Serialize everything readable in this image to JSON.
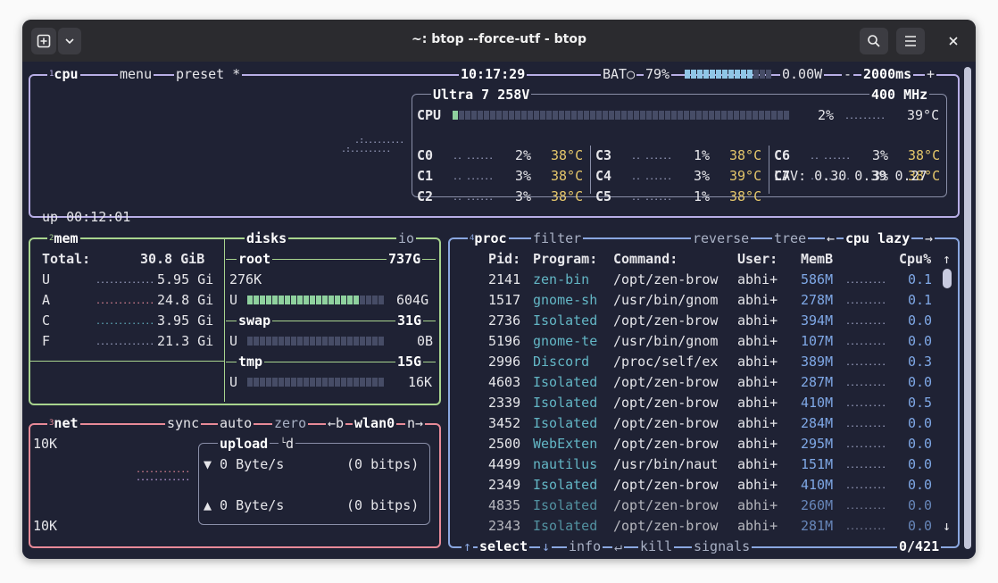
{
  "window": {
    "title": "~: btop --force-utf - btop"
  },
  "titlebar_icons": [
    "new-tab-icon",
    "chevron-down-icon",
    "search-icon",
    "hamburger-icon",
    "close-icon"
  ],
  "colors": {
    "cpu_border": "#b8aee6",
    "mem_border": "#a8d48e",
    "net_border": "#e88a98",
    "proc_border": "#8aa7e0",
    "bg": "#1f2234"
  },
  "cpu": {
    "tab": "cpu",
    "tab_num": "1",
    "menu": "menu",
    "preset": "preset *",
    "time": "10:17:29",
    "battery_label": "BAT○",
    "battery_pct": "79%",
    "battery_value": 0.79,
    "power": "0.00W",
    "interval": "2000ms",
    "interval_minus": "-",
    "interval_plus": "+",
    "model": "Ultra 7 258V",
    "freq": "400 MHz",
    "uptime": "up 00:12:01",
    "total": {
      "label": "CPU",
      "pct": "2%",
      "temp": "39°C"
    },
    "cores": [
      {
        "name": "C0",
        "pct": "2%",
        "temp": "38°C"
      },
      {
        "name": "C1",
        "pct": "3%",
        "temp": "38°C"
      },
      {
        "name": "C2",
        "pct": "3%",
        "temp": "38°C"
      },
      {
        "name": "C3",
        "pct": "1%",
        "temp": "38°C"
      },
      {
        "name": "C4",
        "pct": "3%",
        "temp": "39°C"
      },
      {
        "name": "C5",
        "pct": "1%",
        "temp": "38°C"
      },
      {
        "name": "C6",
        "pct": "3%",
        "temp": "38°C"
      },
      {
        "name": "C7",
        "pct": "3%",
        "temp": "38°C"
      }
    ],
    "lav": "LAV: 0.30 0.39 0.27"
  },
  "mem": {
    "tab": "mem",
    "tab_num": "2",
    "total_label": "Total:",
    "total": "30.8 GiB",
    "rows": [
      {
        "k": "U",
        "v": "5.95 Gi"
      },
      {
        "k": "A",
        "v": "24.8 Gi"
      },
      {
        "k": "C",
        "v": "3.95 Gi"
      },
      {
        "k": "F",
        "v": "21.3 Gi"
      }
    ]
  },
  "disks": {
    "tab": "disks",
    "io": "io",
    "root": {
      "name": "root",
      "size": "737G",
      "io": "276K",
      "used_label": "U",
      "used": "604G",
      "used_frac": 0.82
    },
    "swap": {
      "name": "swap",
      "size": "31G",
      "used_label": "U",
      "used": "0B"
    },
    "tmp": {
      "name": "tmp",
      "size": "15G",
      "used_label": "U",
      "used": "16K"
    }
  },
  "net": {
    "tab": "net",
    "tab_num": "3",
    "sync": "sync",
    "auto": "auto",
    "zero": "zero",
    "b": "←b",
    "iface": "wlan0",
    "n": "n→",
    "top": "10K",
    "bottom": "10K",
    "upload_label": "upload",
    "d": "d",
    "down": "▼ 0 Byte/s",
    "down_bits": "(0 bitps)",
    "up": "▲ 0 Byte/s",
    "up_bits": "(0 bitps)"
  },
  "proc": {
    "tab": "proc",
    "tab_num": "4",
    "filter": "filter",
    "reverse": "reverse",
    "tree": "tree",
    "left": "←",
    "sort": "cpu lazy",
    "right": "→",
    "headers": {
      "pid": "Pid:",
      "program": "Program:",
      "command": "Command:",
      "user": "User:",
      "mem": "MemB",
      "cpu": "Cpu%"
    },
    "rows": [
      {
        "pid": "2141",
        "program": "zen-bin",
        "command": "/opt/zen-brow",
        "user": "abhi+",
        "mem": "586M",
        "cpu": "0.1"
      },
      {
        "pid": "1517",
        "program": "gnome-sh",
        "command": "/usr/bin/gnom",
        "user": "abhi+",
        "mem": "278M",
        "cpu": "0.1"
      },
      {
        "pid": "2736",
        "program": "Isolated",
        "command": "/opt/zen-brow",
        "user": "abhi+",
        "mem": "394M",
        "cpu": "0.0"
      },
      {
        "pid": "5196",
        "program": "gnome-te",
        "command": "/usr/bin/gnom",
        "user": "abhi+",
        "mem": "107M",
        "cpu": "0.0"
      },
      {
        "pid": "2996",
        "program": "Discord",
        "command": "/proc/self/ex",
        "user": "abhi+",
        "mem": "389M",
        "cpu": "0.3"
      },
      {
        "pid": "4603",
        "program": "Isolated",
        "command": "/opt/zen-brow",
        "user": "abhi+",
        "mem": "287M",
        "cpu": "0.0"
      },
      {
        "pid": "2339",
        "program": "Isolated",
        "command": "/opt/zen-brow",
        "user": "abhi+",
        "mem": "410M",
        "cpu": "0.5"
      },
      {
        "pid": "3452",
        "program": "Isolated",
        "command": "/opt/zen-brow",
        "user": "abhi+",
        "mem": "284M",
        "cpu": "0.0"
      },
      {
        "pid": "2500",
        "program": "WebExten",
        "command": "/opt/zen-brow",
        "user": "abhi+",
        "mem": "295M",
        "cpu": "0.0"
      },
      {
        "pid": "4499",
        "program": "nautilus",
        "command": "/usr/bin/naut",
        "user": "abhi+",
        "mem": "151M",
        "cpu": "0.0"
      },
      {
        "pid": "2349",
        "program": "Isolated",
        "command": "/opt/zen-brow",
        "user": "abhi+",
        "mem": "410M",
        "cpu": "0.0"
      },
      {
        "pid": "4835",
        "program": "Isolated",
        "command": "/opt/zen-brow",
        "user": "abhi+",
        "mem": "260M",
        "cpu": "0.0"
      },
      {
        "pid": "2343",
        "program": "Isolated",
        "command": "/opt/zen-brow",
        "user": "abhi+",
        "mem": "281M",
        "cpu": "0.0"
      }
    ],
    "footer": {
      "select": "select",
      "info": "info",
      "kill": "kill",
      "signals": "signals",
      "count": "0/421"
    }
  }
}
